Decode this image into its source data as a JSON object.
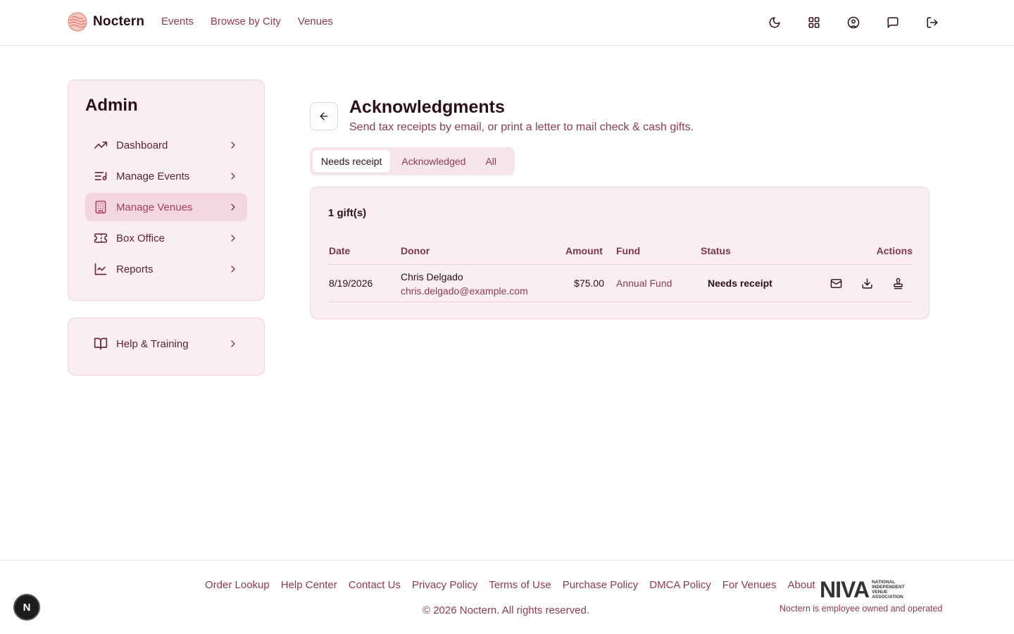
{
  "brand": {
    "name": "Noctern"
  },
  "nav": {
    "items": [
      "Events",
      "Browse by City",
      "Venues"
    ]
  },
  "sidebar": {
    "title": "Admin",
    "items": [
      {
        "label": "Dashboard",
        "icon": "trending-up-icon"
      },
      {
        "label": "Manage Events",
        "icon": "list-music-icon"
      },
      {
        "label": "Manage Venues",
        "icon": "building-icon",
        "active": true
      },
      {
        "label": "Box Office",
        "icon": "ticket-icon"
      },
      {
        "label": "Reports",
        "icon": "line-chart-icon"
      }
    ],
    "help": {
      "label": "Help & Training",
      "icon": "book-open-icon"
    }
  },
  "page": {
    "title": "Acknowledgments",
    "subtitle": "Send tax receipts by email, or print a letter to mail check & cash gifts."
  },
  "tabs": [
    "Needs receipt",
    "Acknowledged",
    "All"
  ],
  "gifts": {
    "count_label": "1 gift(s)",
    "columns": [
      "Date",
      "Donor",
      "Amount",
      "Fund",
      "Status",
      "Actions"
    ],
    "rows": [
      {
        "date": "8/19/2026",
        "donor": "Chris Delgado",
        "email": "chris.delgado@example.com",
        "amount": "$75.00",
        "fund": "Annual Fund",
        "status": "Needs receipt"
      }
    ]
  },
  "footer": {
    "links": [
      "Order Lookup",
      "Help Center",
      "Contact Us",
      "Privacy Policy",
      "Terms of Use",
      "Purchase Policy",
      "DMCA Policy",
      "For Venues",
      "About"
    ],
    "copyright": "© 2026 Noctern. All rights reserved.",
    "niva_big": "NIVA",
    "niva_small": "NATIONAL INDEPENDENT VENUE ASSOCIATION",
    "employee": "Noctern is employee owned and operated"
  },
  "badge": {
    "letter": "N"
  },
  "colors": {
    "accent": "#8a3a55",
    "card_bg": "#faeef1",
    "active_bg": "#f4d6df",
    "text": "#2a0f1c"
  }
}
